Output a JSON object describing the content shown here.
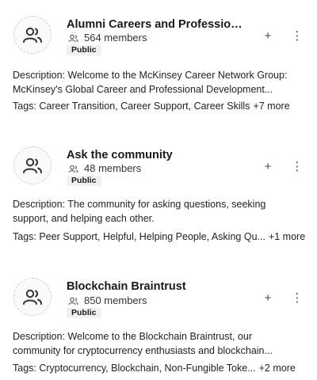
{
  "groups": [
    {
      "title": "Alumni Careers and Professional...",
      "members": "564 members",
      "badge": "Public",
      "description_line1": "Description: Welcome to the McKinsey Career Network Group:",
      "description_line2": "McKinsey's Global Career and Professional Development...",
      "tags": "Tags: Career Transition, Career Support, Career Skills",
      "tags_more": "+7 more"
    },
    {
      "title": "Ask the community",
      "members": "48 members",
      "badge": "Public",
      "description_line1": "Description: The community for asking questions, seeking",
      "description_line2": "support, and helping each other.",
      "tags": "Tags: Peer Support, Helpful, Helping People, Asking Qu...",
      "tags_more": "+1 more"
    },
    {
      "title": "Blockchain Braintrust",
      "members": "850 members",
      "badge": "Public",
      "description_line1": "Description: Welcome to the Blockchain Braintrust, our",
      "description_line2": "community for cryptocurrency enthusiasts and blockchain...",
      "tags": "Tags: Cryptocurrency, Blockchain, Non-Fungible Toke...",
      "tags_more": "+2 more"
    }
  ],
  "icons": {
    "avatar": "group-avatar-icon",
    "members": "members-icon",
    "join": "plus-icon",
    "menu": "more-vertical-icon"
  },
  "labels": {
    "plus": "+",
    "more": "⋮"
  }
}
